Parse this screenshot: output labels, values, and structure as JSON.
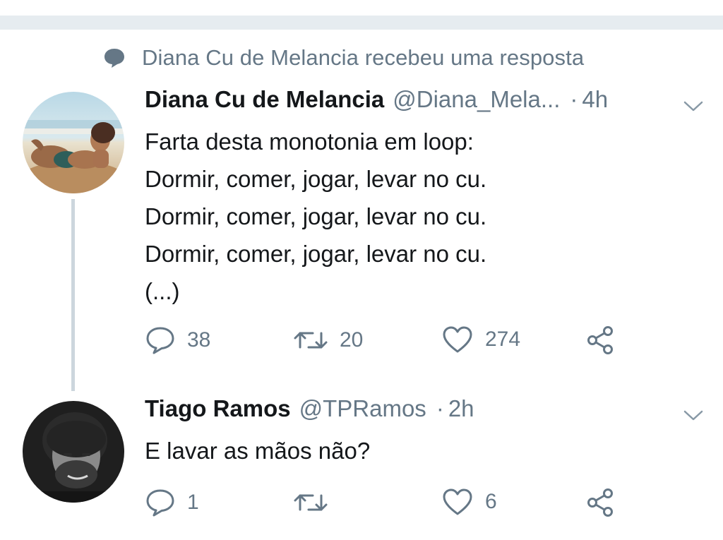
{
  "context": {
    "text": "Diana Cu de Melancia recebeu uma resposta"
  },
  "tweets": [
    {
      "name": "Diana Cu de Melancia",
      "handle": "@Diana_Mela...",
      "separator": "·",
      "time": "4h",
      "lines": [
        "Farta desta monotonia em loop:",
        "Dormir, comer, jogar, levar no cu.",
        "Dormir, comer, jogar, levar no cu.",
        "Dormir, comer, jogar, levar no cu.",
        "(...)"
      ],
      "reply_count": "38",
      "retweet_count": "20",
      "like_count": "274"
    },
    {
      "name": "Tiago Ramos",
      "handle": "@TPRamos",
      "separator": "·",
      "time": "2h",
      "lines": [
        "E lavar as mãos não?"
      ],
      "reply_count": "1",
      "retweet_count": "",
      "like_count": "6"
    }
  ],
  "colors": {
    "text_primary": "#14171a",
    "text_secondary": "#657786",
    "thread_line": "#ccd6dd",
    "top_bar": "#e6ecf0"
  }
}
